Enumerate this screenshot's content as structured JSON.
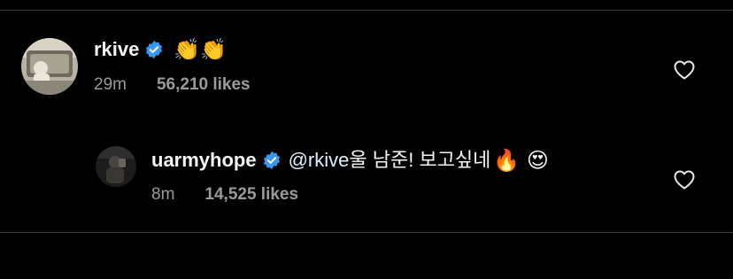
{
  "comments": [
    {
      "username": "rkive",
      "verified": true,
      "verified_icon": "verified-badge-icon",
      "mention": "",
      "text": "",
      "emoji": "👏👏",
      "time": "29m",
      "likes": "56,210 likes",
      "like_icon": "heart-outline-icon"
    },
    {
      "username": "uarmyhope",
      "verified": true,
      "verified_icon": "verified-badge-icon",
      "mention": "@rkive",
      "text": " 울 남준! 보고싶네",
      "emoji": "🔥 😍",
      "time": "8m",
      "likes": "14,525 likes",
      "like_icon": "heart-outline-icon"
    }
  ],
  "colors": {
    "background": "#000000",
    "verified": "#3897f0",
    "muted_text": "#9a9a9a",
    "divider": "#3a3a3a"
  }
}
